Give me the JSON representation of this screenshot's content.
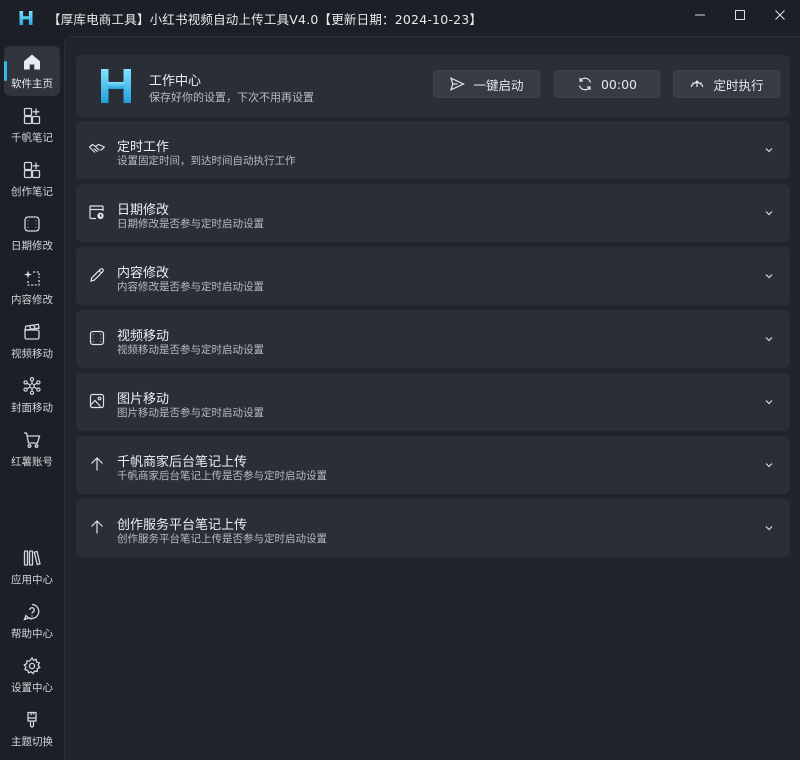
{
  "window": {
    "title": "【厚库电商工具】小红书视频自动上传工具V4.0【更新日期：2024-10-23】",
    "controls": [
      "minimize-icon",
      "maximize-icon",
      "close-icon"
    ]
  },
  "colors": {
    "accent": "#3fb6e8",
    "background": "#1c1f26",
    "panel": "#2a2e36"
  },
  "sidebar": {
    "items": [
      {
        "label": "软件主页",
        "icon": "home-icon",
        "active": true
      },
      {
        "label": "千帆笔记",
        "icon": "apps-add-icon"
      },
      {
        "label": "创作笔记",
        "icon": "apps-add-icon"
      },
      {
        "label": "日期修改",
        "icon": "filmstrip-icon"
      },
      {
        "label": "内容修改",
        "icon": "sparkle-select-icon"
      },
      {
        "label": "视频移动",
        "icon": "clapperboard-icon"
      },
      {
        "label": "封面移动",
        "icon": "share-nodes-icon"
      },
      {
        "label": "红薯账号",
        "icon": "cart-icon"
      }
    ],
    "bottom_items": [
      {
        "label": "应用中心",
        "icon": "library-icon"
      },
      {
        "label": "帮助中心",
        "icon": "help-chat-icon"
      },
      {
        "label": "设置中心",
        "icon": "gear-icon"
      },
      {
        "label": "主题切换",
        "icon": "paintbrush-icon"
      }
    ]
  },
  "header": {
    "title": "工作中心",
    "subtitle": "保存好你的设置，下次不用再设置",
    "buttons": {
      "start": {
        "label": "一键启动",
        "icon": "send-icon"
      },
      "timer": {
        "label": "00:00",
        "icon": "sync-icon"
      },
      "scheduled": {
        "label": "定时执行",
        "icon": "timer-gauge-icon"
      }
    }
  },
  "sections": [
    {
      "title": "定时工作",
      "subtitle": "设置固定时间，到达时间自动执行工作",
      "icon": "handshake-icon"
    },
    {
      "title": "日期修改",
      "subtitle": "日期修改是否参与定时启动设置",
      "icon": "calendar-clock-icon"
    },
    {
      "title": "内容修改",
      "subtitle": "内容修改是否参与定时启动设置",
      "icon": "pencil-icon"
    },
    {
      "title": "视频移动",
      "subtitle": "视频移动是否参与定时启动设置",
      "icon": "filmstrip-icon"
    },
    {
      "title": "图片移动",
      "subtitle": "图片移动是否参与定时启动设置",
      "icon": "image-icon"
    },
    {
      "title": "千帆商家后台笔记上传",
      "subtitle": "千帆商家后台笔记上传是否参与定时启动设置",
      "icon": "arrow-up-icon"
    },
    {
      "title": "创作服务平台笔记上传",
      "subtitle": "创作服务平台笔记上传是否参与定时启动设置",
      "icon": "arrow-up-icon"
    }
  ]
}
